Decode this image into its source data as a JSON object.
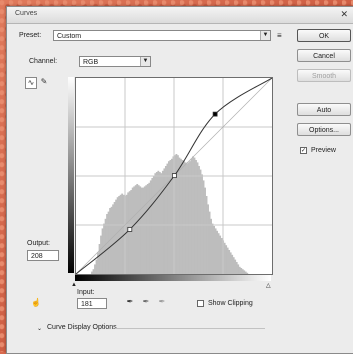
{
  "window": {
    "title": "Curves"
  },
  "preset": {
    "label": "Preset:",
    "value": "Custom",
    "menu_glyph": "≡"
  },
  "channel": {
    "label": "Channel:",
    "value": "RGB"
  },
  "buttons": {
    "ok": "OK",
    "cancel": "Cancel",
    "smooth": "Smooth",
    "auto": "Auto",
    "options": "Options..."
  },
  "preview": {
    "label": "Preview",
    "checked": true
  },
  "output": {
    "label": "Output:",
    "value": "208"
  },
  "input": {
    "label": "Input:",
    "value": "181"
  },
  "show_clipping": {
    "label": "Show Clipping",
    "checked": false
  },
  "curve_display": {
    "label": "Curve Display Options"
  },
  "curve": {
    "points": [
      [
        0,
        0
      ],
      [
        70,
        58
      ],
      [
        128,
        128
      ],
      [
        181,
        208
      ],
      [
        255,
        255
      ]
    ],
    "selected_point": [
      181,
      208
    ]
  },
  "histogram": {
    "levels": [
      0,
      0,
      0,
      0,
      0,
      0,
      0,
      0,
      0,
      0,
      2,
      4,
      8,
      12,
      18,
      25,
      32,
      38,
      42,
      46,
      50,
      52,
      55,
      56,
      58,
      60,
      62,
      64,
      65,
      66,
      67,
      66,
      65,
      66,
      68,
      69,
      70,
      72,
      73,
      74,
      75,
      74,
      73,
      72,
      72,
      73,
      74,
      75,
      76,
      78,
      80,
      82,
      84,
      85,
      86,
      85,
      84,
      86,
      88,
      90,
      92,
      94,
      95,
      96,
      98,
      99,
      100,
      99,
      97,
      96,
      95,
      94,
      93,
      92,
      93,
      94,
      96,
      98,
      97,
      95,
      93,
      90,
      87,
      83,
      78,
      72,
      65,
      58,
      52,
      46,
      42,
      40,
      38,
      36,
      34,
      32,
      30,
      28,
      26,
      24,
      22,
      20,
      18,
      16,
      14,
      12,
      10,
      8,
      6,
      5,
      4,
      3,
      2,
      1,
      0,
      0,
      0,
      0,
      0,
      0,
      0,
      0,
      0,
      0,
      0,
      0,
      0,
      0,
      0,
      0
    ]
  },
  "colors": {
    "accent": "#000000",
    "dialog_bg": "#ececec",
    "histogram": "#bdbdbd",
    "background": "#d96a4e"
  }
}
